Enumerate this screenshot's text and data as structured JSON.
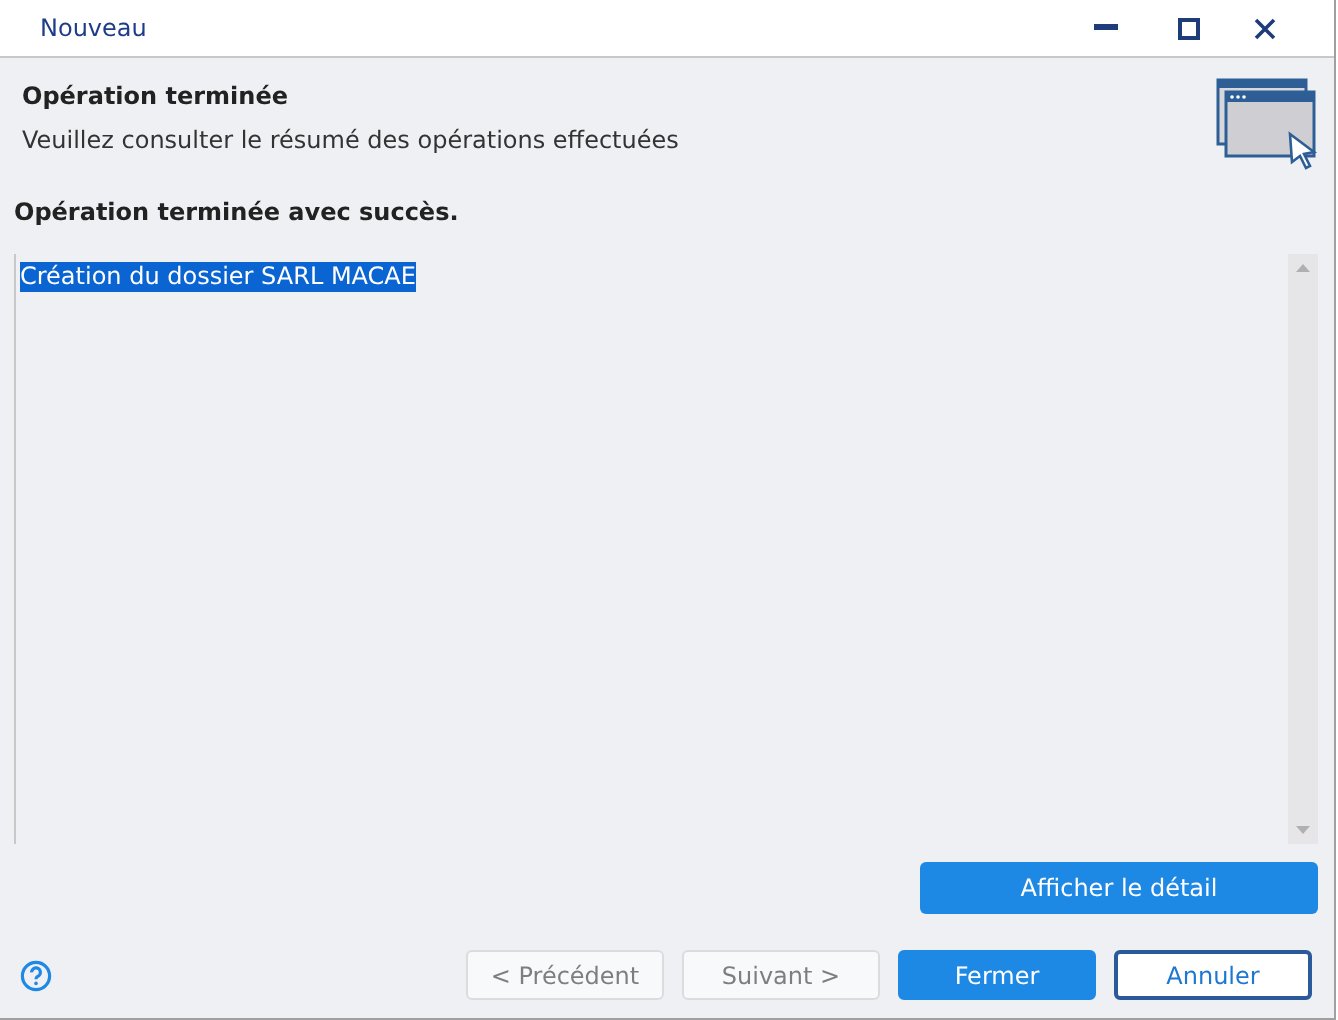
{
  "window": {
    "title": "Nouveau"
  },
  "header": {
    "title": "Opération terminée",
    "subtitle": "Veuillez consulter le résumé des opérations effectuées"
  },
  "status": "Opération terminée avec succès.",
  "log": {
    "lines": [
      {
        "text": "Création du dossier SARL MACAE",
        "selected": true
      }
    ]
  },
  "detail_button": "Afficher le détail",
  "buttons": [
    {
      "label": "< Précédent",
      "kind": "secondary",
      "disabled": true
    },
    {
      "label": "Suivant >",
      "kind": "secondary",
      "disabled": true
    },
    {
      "label": "Fermer",
      "kind": "primary",
      "disabled": false
    },
    {
      "label": "Annuler",
      "kind": "outline",
      "disabled": false
    }
  ]
}
